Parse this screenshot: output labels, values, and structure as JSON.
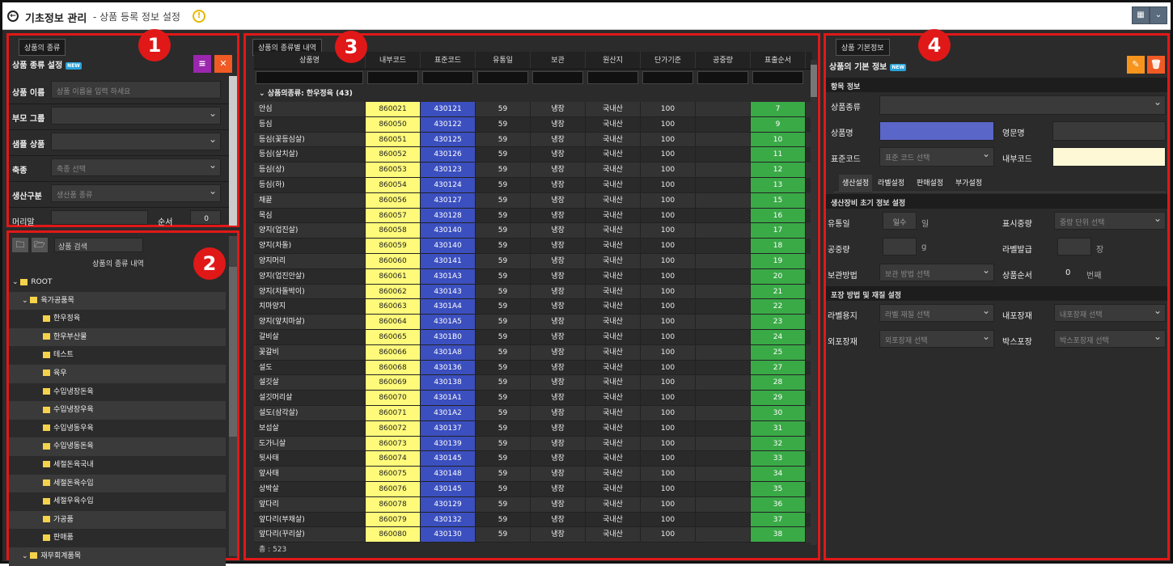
{
  "titlebar": {
    "title_main": "기초정보 관리",
    "title_sub": "- 상품 등록 정보 설정",
    "warn": "!"
  },
  "panel1": {
    "tab": "상품의 종류",
    "section_title": "상품 종류 설정",
    "new_tag": "NEW",
    "labels": {
      "name": "상품 이름",
      "parent": "부모 그룹",
      "sample": "샘플 상품",
      "species": "축종",
      "production": "생산구분",
      "header": "머리말",
      "order": "순서"
    },
    "placeholders": {
      "name": "상품 이름을 입력 하세요",
      "species": "축종 선택",
      "production": "생산품 종류"
    },
    "order_value": "0",
    "badge": "1"
  },
  "panel2": {
    "search": "상품 검색",
    "header": "상품의 종류 내역",
    "badge": "2",
    "tree": [
      {
        "label": "ROOT",
        "level": 0,
        "caret": "⌄"
      },
      {
        "label": "육가공품목",
        "level": 1,
        "caret": "⌄"
      },
      {
        "label": "한우정육",
        "level": 2
      },
      {
        "label": "한우부산물",
        "level": 2
      },
      {
        "label": "테스트",
        "level": 2
      },
      {
        "label": "육우",
        "level": 2
      },
      {
        "label": "수입냉장돈육",
        "level": 2
      },
      {
        "label": "수입냉장우육",
        "level": 2
      },
      {
        "label": "수입냉동우육",
        "level": 2
      },
      {
        "label": "수입냉동돈육",
        "level": 2
      },
      {
        "label": "세절돈육국내",
        "level": 2
      },
      {
        "label": "세절돈육수입",
        "level": 2
      },
      {
        "label": "세절우육수입",
        "level": 2
      },
      {
        "label": "가공품",
        "level": 2
      },
      {
        "label": "판매품",
        "level": 2
      },
      {
        "label": "재무회계품목",
        "level": 1,
        "caret": "⌄"
      }
    ]
  },
  "panel3": {
    "tab": "상품의 종류별 내역",
    "badge": "3",
    "group": "상품의종류: 한우정육 (43)",
    "total": "총 : 523",
    "columns": [
      "상품명",
      "내부코드",
      "표준코드",
      "유통일",
      "보관",
      "원산지",
      "단가기준",
      "공중량",
      "표출순서"
    ],
    "rows": [
      [
        "안심",
        "860021",
        "430121",
        "59",
        "냉장",
        "국내산",
        "100",
        "",
        "7"
      ],
      [
        "등심",
        "860050",
        "430122",
        "59",
        "냉장",
        "국내산",
        "100",
        "",
        "9"
      ],
      [
        "등심(꽃등심살)",
        "860051",
        "430125",
        "59",
        "냉장",
        "국내산",
        "100",
        "",
        "10"
      ],
      [
        "등심(살치살)",
        "860052",
        "430126",
        "59",
        "냉장",
        "국내산",
        "100",
        "",
        "11"
      ],
      [
        "등심(상)",
        "860053",
        "430123",
        "59",
        "냉장",
        "국내산",
        "100",
        "",
        "12"
      ],
      [
        "등심(하)",
        "860054",
        "430124",
        "59",
        "냉장",
        "국내산",
        "100",
        "",
        "13"
      ],
      [
        "채끝",
        "860056",
        "430127",
        "59",
        "냉장",
        "국내산",
        "100",
        "",
        "15"
      ],
      [
        "목심",
        "860057",
        "430128",
        "59",
        "냉장",
        "국내산",
        "100",
        "",
        "16"
      ],
      [
        "양지(업진살)",
        "860058",
        "430140",
        "59",
        "냉장",
        "국내산",
        "100",
        "",
        "17"
      ],
      [
        "양지(차돌)",
        "860059",
        "430140",
        "59",
        "냉장",
        "국내산",
        "100",
        "",
        "18"
      ],
      [
        "양지머리",
        "860060",
        "430141",
        "59",
        "냉장",
        "국내산",
        "100",
        "",
        "19"
      ],
      [
        "양지(업진안살)",
        "860061",
        "4301A3",
        "59",
        "냉장",
        "국내산",
        "100",
        "",
        "20"
      ],
      [
        "양지(차돌박이)",
        "860062",
        "430143",
        "59",
        "냉장",
        "국내산",
        "100",
        "",
        "21"
      ],
      [
        "치마양지",
        "860063",
        "4301A4",
        "59",
        "냉장",
        "국내산",
        "100",
        "",
        "22"
      ],
      [
        "양지(앞치마살)",
        "860064",
        "4301A5",
        "59",
        "냉장",
        "국내산",
        "100",
        "",
        "23"
      ],
      [
        "갈비살",
        "860065",
        "4301B0",
        "59",
        "냉장",
        "국내산",
        "100",
        "",
        "24"
      ],
      [
        "꽃갈비",
        "860066",
        "4301A8",
        "59",
        "냉장",
        "국내산",
        "100",
        "",
        "25"
      ],
      [
        "설도",
        "860068",
        "430136",
        "59",
        "냉장",
        "국내산",
        "100",
        "",
        "27"
      ],
      [
        "설깃살",
        "860069",
        "430138",
        "59",
        "냉장",
        "국내산",
        "100",
        "",
        "28"
      ],
      [
        "설깃머리살",
        "860070",
        "4301A1",
        "59",
        "냉장",
        "국내산",
        "100",
        "",
        "29"
      ],
      [
        "설도(삼각살)",
        "860071",
        "4301A2",
        "59",
        "냉장",
        "국내산",
        "100",
        "",
        "30"
      ],
      [
        "보섭살",
        "860072",
        "430137",
        "59",
        "냉장",
        "국내산",
        "100",
        "",
        "31"
      ],
      [
        "도가니살",
        "860073",
        "430139",
        "59",
        "냉장",
        "국내산",
        "100",
        "",
        "32"
      ],
      [
        "뒷사태",
        "860074",
        "430145",
        "59",
        "냉장",
        "국내산",
        "100",
        "",
        "33"
      ],
      [
        "앞사태",
        "860075",
        "430148",
        "59",
        "냉장",
        "국내산",
        "100",
        "",
        "34"
      ],
      [
        "상박살",
        "860076",
        "430145",
        "59",
        "냉장",
        "국내산",
        "100",
        "",
        "35"
      ],
      [
        "앞다리",
        "860078",
        "430129",
        "59",
        "냉장",
        "국내산",
        "100",
        "",
        "36"
      ],
      [
        "앞다리(부채살)",
        "860079",
        "430132",
        "59",
        "냉장",
        "국내산",
        "100",
        "",
        "37"
      ],
      [
        "앞다리(꾸리살)",
        "860080",
        "430130",
        "59",
        "냉장",
        "국내산",
        "100",
        "",
        "38"
      ]
    ]
  },
  "panel4": {
    "tab": "상품 기본정보",
    "badge": "4",
    "section_title": "상품의 기본 정보",
    "new_tag": "NEW",
    "item_info": "항목 정보",
    "labels": {
      "kind": "상품종류",
      "name": "상품명",
      "eng": "영문명",
      "std": "표준코드",
      "inner": "내부코드"
    },
    "std_placeholder": "표준 코드 선택",
    "subtabs": [
      "생산설정",
      "라벨설정",
      "판매설정",
      "부가설정"
    ],
    "prod_section": "생산장비 초기 정보 설정",
    "prod": {
      "shelf": "유통일",
      "shelf_ph": "일수",
      "shelf_unit": "일",
      "weight_disp": "표시중량",
      "weight_ph": "중량 단위 선택",
      "tare": "공중량",
      "tare_unit": "g",
      "label_issue": "라벨발급",
      "label_unit": "장",
      "storage": "보관방법",
      "storage_ph": "보관 방법 선택",
      "order": "상품순서",
      "order_val": "0",
      "order_unit": "번째"
    },
    "pack_section": "포장 방법 및 재질 설정",
    "pack": {
      "label_paper": "라벨용지",
      "label_paper_ph": "라벨 재질 선택",
      "inner": "내포장재",
      "inner_ph": "내포장재 선택",
      "outer": "외포장재",
      "outer_ph": "외포장재 선택",
      "box": "박스포장",
      "box_ph": "박스포장재 선택"
    }
  }
}
